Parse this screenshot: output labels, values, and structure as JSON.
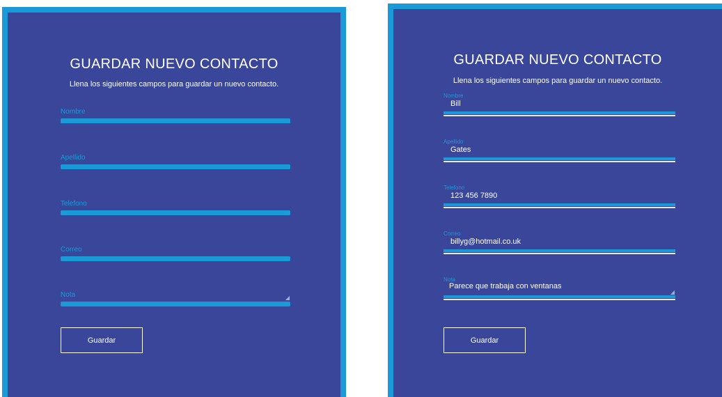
{
  "colors": {
    "panel_bg": "#39469a",
    "accent": "#1b9ad8",
    "text": "#ffffff"
  },
  "empty_form": {
    "title": "GUARDAR NUEVO CONTACTO",
    "subtitle": "Llena los siguientes campos para guardar un nuevo contacto.",
    "fields": [
      {
        "label": "Nombre",
        "value": ""
      },
      {
        "label": "Apellido",
        "value": ""
      },
      {
        "label": "Telefono",
        "value": ""
      },
      {
        "label": "Correo",
        "value": ""
      },
      {
        "label": "Nota",
        "value": ""
      }
    ],
    "button_label": "Guardar"
  },
  "filled_form": {
    "title": "GUARDAR NUEVO CONTACTO",
    "subtitle": "Llena los siguientes campos para guardar un nuevo contacto.",
    "fields": [
      {
        "label": "Nombre",
        "value": "Bill"
      },
      {
        "label": "Apellido",
        "value": "Gates"
      },
      {
        "label": "Telefono",
        "value": "123 456 7890"
      },
      {
        "label": "Correo",
        "value": "billyg@hotmail.co.uk"
      },
      {
        "label": "Nota",
        "value": "Parece que trabaja con ventanas"
      }
    ],
    "button_label": "Guardar"
  }
}
